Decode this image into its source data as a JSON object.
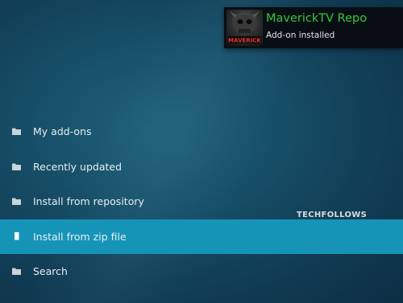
{
  "notification": {
    "title": "MaverickTV Repo",
    "message": "Add-on installed",
    "thumbnail_icon": "mavericktv-logo-icon",
    "thumbnail_text": "MAVERICK"
  },
  "menu": {
    "items": [
      {
        "label": "My add-ons",
        "icon": "folder-icon",
        "selected": false
      },
      {
        "label": "Recently updated",
        "icon": "folder-icon",
        "selected": false
      },
      {
        "label": "Install from repository",
        "icon": "folder-icon",
        "selected": false
      },
      {
        "label": "Install from zip file",
        "icon": "file-icon",
        "selected": true
      },
      {
        "label": "Search",
        "icon": "folder-icon",
        "selected": false
      }
    ]
  },
  "watermark": "TECHFOLLOWS",
  "colors": {
    "background": "#17506a",
    "selected_row": "#1694b8",
    "notification_title": "#37c83b",
    "toast_background": "#080e14"
  }
}
